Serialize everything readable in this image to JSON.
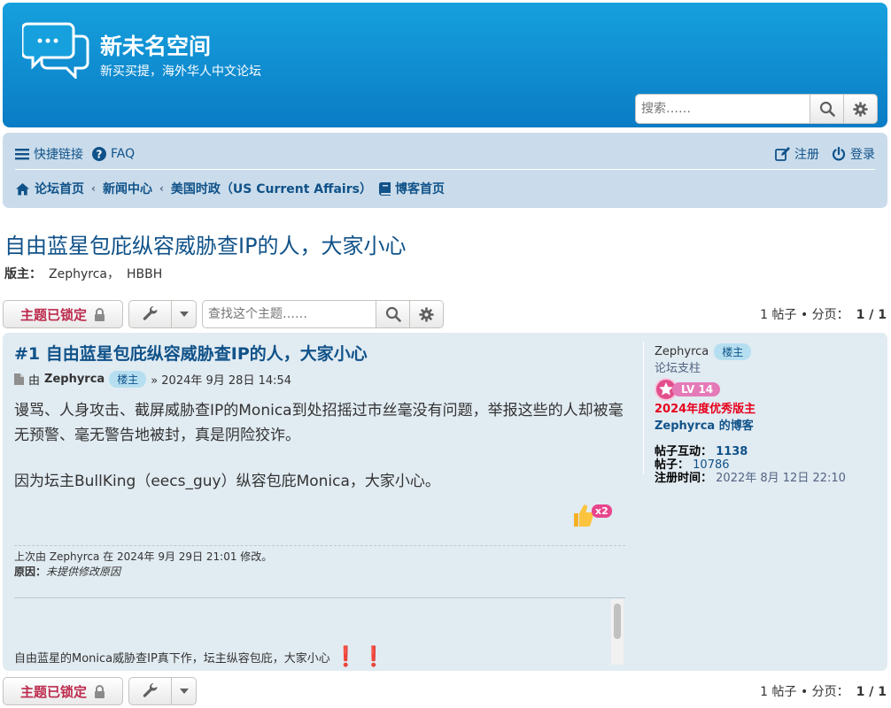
{
  "header": {
    "site_title": "新未名空间",
    "site_desc": "新买买提，海外华人中文论坛",
    "search_placeholder": "搜索……"
  },
  "nav": {
    "quick_links": "快捷链接",
    "faq": "FAQ",
    "register": "注册",
    "login": "登录"
  },
  "breadcrumbs": [
    "论坛首页",
    "新闻中心",
    "美国时政（US Current Affairs）",
    "博客首页"
  ],
  "topic": {
    "title": "自由蓝星包庇纵容威胁查IP的人，大家小心",
    "mods_label": "版主：",
    "mods": [
      "Zephyrca，",
      "HBBH"
    ]
  },
  "action_bar": {
    "locked_label": "主题已锁定",
    "search_placeholder": "查找这个主题……",
    "pagination_text": "1 帖子 • 分页：",
    "pagination_pages": "1 / 1"
  },
  "post": {
    "title": "#1 自由蓝星包庇纵容威胁查IP的人，大家小心",
    "by": "由",
    "author": "Zephyrca",
    "author_badge": "楼主",
    "datetime": "» 2024年 9月 28日 14:54",
    "paragraphs": [
      "谩骂、人身攻击、截屏威胁查IP的Monica到处招摇过市丝毫没有问题，举报这些的人却被毫无预警、毫无警告地被封，真是阴险狡诈。",
      "因为坛主BullKing（eecs_guy）纵容包庇Monica，大家小心。"
    ],
    "reaction_count": "x2",
    "edit_note": "上次由 Zephyrca 在 2024年 9月 29日 21:01 修改。",
    "reason_label": "原因：",
    "reason_text": "未提供修改原因",
    "signature": "自由蓝星的Monica威胁查IP真下作，坛主纵容包庇，大家小心"
  },
  "profile": {
    "name": "Zephyrca",
    "badge": "楼主",
    "rank": "论坛支柱",
    "level": "LV 14",
    "award": "2024年度优秀版主",
    "blog": "Zephyrca 的博客",
    "interactions_label": "帖子互动：",
    "interactions": "1138",
    "posts_label": "帖子：",
    "posts": "10786",
    "joined_label": "注册时间：",
    "joined": "2022年 8月 12日 22:10"
  },
  "colors": {
    "header": "#0a7cc5",
    "navbar": "#cadceb",
    "post_bg": "#e1ebf2",
    "link": "#105289",
    "locked": "#bc2a4d",
    "award": "#e8001c"
  }
}
